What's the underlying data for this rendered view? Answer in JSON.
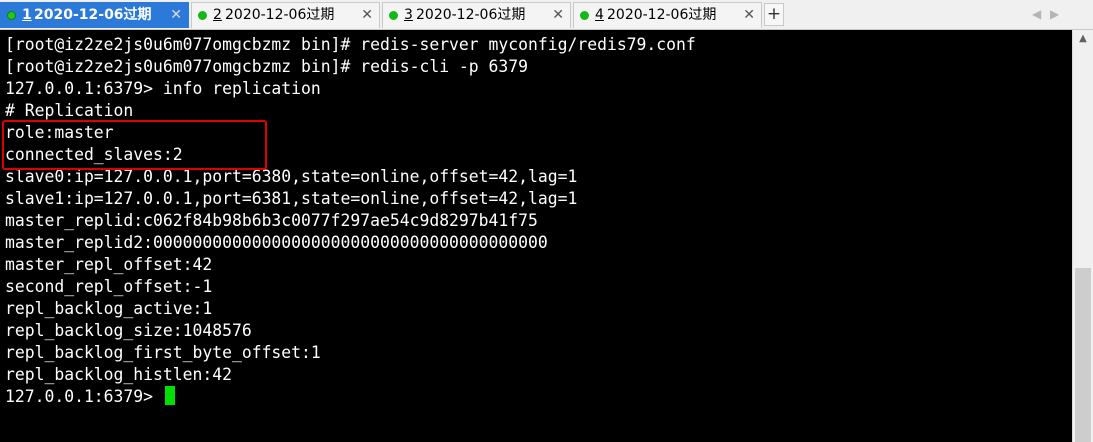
{
  "tabs": [
    {
      "number": "1",
      "title": "2020-12-06过期",
      "active": true,
      "status_color": "#22c522"
    },
    {
      "number": "2",
      "title": "2020-12-06过期",
      "active": false,
      "status_color": "#14b814"
    },
    {
      "number": "3",
      "title": "2020-12-06过期",
      "active": false,
      "status_color": "#14b814"
    },
    {
      "number": "4",
      "title": "2020-12-06过期",
      "active": false,
      "status_color": "#14b814"
    }
  ],
  "tab_close_glyph": "✕",
  "add_tab_glyph": "+",
  "nav_arrows": {
    "left": "◀",
    "right": "▶"
  },
  "terminal": {
    "lines": [
      "[root@iz2ze2js0u6m077omgcbzmz bin]# redis-server myconfig/redis79.conf",
      "[root@iz2ze2js0u6m077omgcbzmz bin]# redis-cli -p 6379",
      "127.0.0.1:6379> info replication",
      "# Replication",
      "role:master",
      "connected_slaves:2",
      "slave0:ip=127.0.0.1,port=6380,state=online,offset=42,lag=1",
      "slave1:ip=127.0.0.1,port=6381,state=online,offset=42,lag=1",
      "master_replid:c062f84b98b6b3c0077f297ae54c9d8297b41f75",
      "master_replid2:0000000000000000000000000000000000000000",
      "master_repl_offset:42",
      "second_repl_offset:-1",
      "repl_backlog_active:1",
      "repl_backlog_size:1048576",
      "repl_backlog_first_byte_offset:1",
      "repl_backlog_histlen:42"
    ],
    "prompt": "127.0.0.1:6379> ",
    "cursor_color": "#00e000",
    "highlight_color": "#e00000"
  },
  "colors": {
    "active_tab": "#2b79d9",
    "terminal_bg": "#000000",
    "terminal_fg": "#ffffff"
  },
  "scrollbar": {
    "up_glyph": "▲"
  }
}
